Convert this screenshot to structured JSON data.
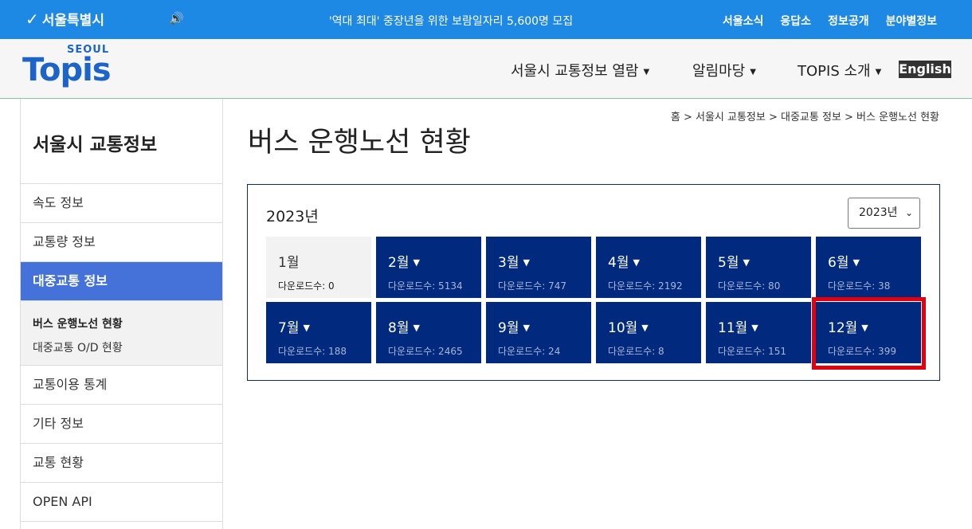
{
  "topbar": {
    "seoul_logo": "서울특별시",
    "notice": "'역대 최대' 중장년을 위한 보람일자리 5,600명 모집",
    "links": [
      "서울소식",
      "응답소",
      "정보공개",
      "분야별정보"
    ]
  },
  "header": {
    "logo_small": "SEOUL",
    "logo_word": "Topis",
    "nav": [
      "서울시 교통정보 열람",
      "알림마당",
      "TOPIS 소개"
    ],
    "english": "English"
  },
  "sidebar": {
    "title": "서울시 교통정보",
    "items": [
      "속도 정보",
      "교통량 정보",
      "대중교통 정보"
    ],
    "sub_items": [
      "버스 운행노선 현황",
      "대중교통 O/D 현황"
    ],
    "items_after": [
      "교통이용 통계",
      "기타 정보",
      "교통 현황",
      "OPEN API"
    ]
  },
  "breadcrumb": "홈 > 서울시 교통정보 > 대중교통 정보 > 버스 운행노선 현황",
  "page_title": "버스 운행노선 현황",
  "panel": {
    "year_label": "2023년",
    "year_select": "2023년",
    "months": [
      {
        "label": "1월",
        "count": "다운로드수: 0",
        "enabled": false
      },
      {
        "label": "2월",
        "count": "다운로드수: 5134",
        "enabled": true
      },
      {
        "label": "3월",
        "count": "다운로드수: 747",
        "enabled": true
      },
      {
        "label": "4월",
        "count": "다운로드수: 2192",
        "enabled": true
      },
      {
        "label": "5월",
        "count": "다운로드수: 80",
        "enabled": true
      },
      {
        "label": "6월",
        "count": "다운로드수: 38",
        "enabled": true
      },
      {
        "label": "7월",
        "count": "다운로드수: 188",
        "enabled": true
      },
      {
        "label": "8월",
        "count": "다운로드수: 2465",
        "enabled": true
      },
      {
        "label": "9월",
        "count": "다운로드수: 24",
        "enabled": true
      },
      {
        "label": "10월",
        "count": "다운로드수: 8",
        "enabled": true
      },
      {
        "label": "11월",
        "count": "다운로드수: 151",
        "enabled": true
      },
      {
        "label": "12월",
        "count": "다운로드수: 399",
        "enabled": true
      }
    ]
  },
  "colors": {
    "topbar": "#1e88e5",
    "month_tile": "#012a7f",
    "active_menu": "#4472d9",
    "highlight": "#e3000f"
  }
}
